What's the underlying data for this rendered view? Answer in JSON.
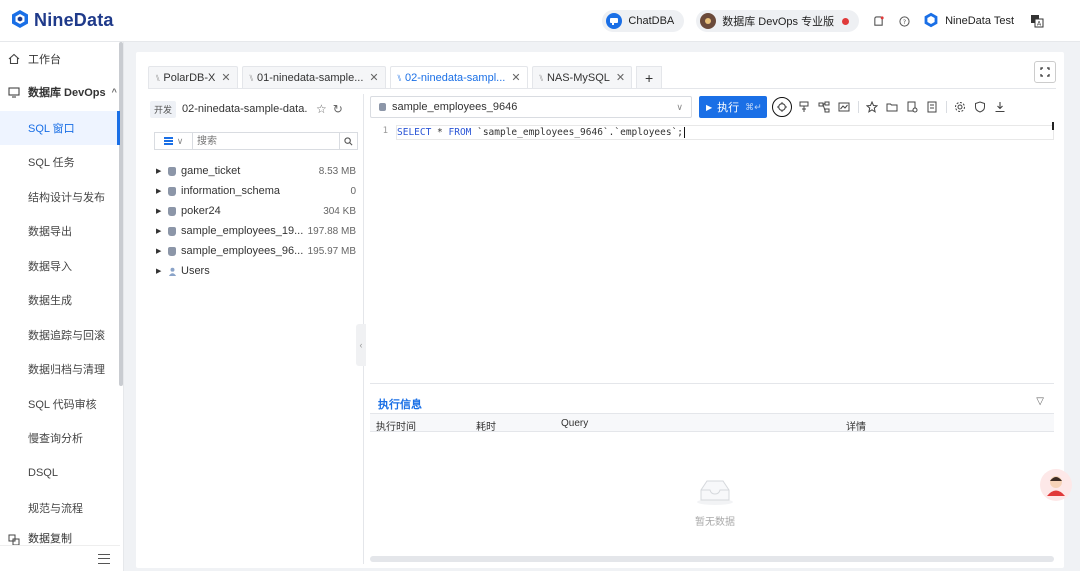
{
  "header": {
    "logo_text": "NineData",
    "chatdba_label": "ChatDBA",
    "plan_label": "数据库 DevOps 专业版",
    "user_name": "NineData Test"
  },
  "sidebar": {
    "workbench": "工作台",
    "devops_group": "数据库 DevOps",
    "items": [
      "SQL 窗口",
      "SQL 任务",
      "结构设计与发布",
      "数据导出",
      "数据导入",
      "数据生成",
      "数据追踪与回滚",
      "数据归档与清理",
      "SQL 代码审核",
      "慢查询分析",
      "DSQL",
      "规范与流程"
    ],
    "next_group": "数据复制"
  },
  "tabs": [
    {
      "label": "PolarDB-X",
      "active": false
    },
    {
      "label": "01-ninedata-sample...",
      "active": false
    },
    {
      "label": "02-ninedata-sampl...",
      "active": true
    },
    {
      "label": "NAS-MySQL",
      "active": false
    }
  ],
  "tree": {
    "env_tag": "开发",
    "env_name": "02-ninedata-sample-data...",
    "search_placeholder": "搜索",
    "items": [
      {
        "name": "game_ticket",
        "size": "8.53 MB"
      },
      {
        "name": "information_schema",
        "size": "0"
      },
      {
        "name": "poker24",
        "size": "304 KB"
      },
      {
        "name": "sample_employees_19...",
        "size": "197.88 MB"
      },
      {
        "name": "sample_employees_96...",
        "size": "195.97 MB"
      },
      {
        "name": "Users",
        "size": ""
      }
    ]
  },
  "editor": {
    "database": "sample_employees_9646",
    "run_label": "执行",
    "run_shortcut": "⌘↵",
    "line_number": "1",
    "sql_kw1": "SELECT",
    "sql_mid": " * ",
    "sql_kw2": "FROM",
    "sql_rest": " `sample_employees_9646`.`employees`;"
  },
  "results": {
    "tab_label": "执行信息",
    "columns": [
      "执行时间",
      "耗时",
      "Query",
      "详情"
    ],
    "empty_text": "暂无数据"
  },
  "colors": {
    "primary": "#1a6fe6",
    "brand": "#1f3a8a"
  }
}
